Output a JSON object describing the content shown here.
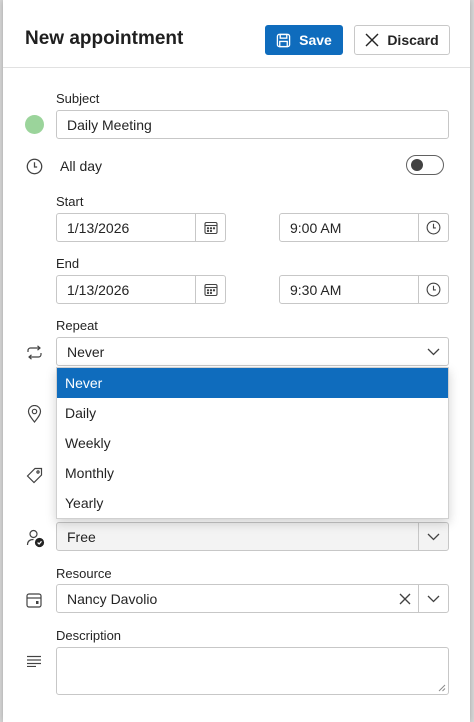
{
  "header": {
    "title": "New appointment",
    "save_label": "Save",
    "discard_label": "Discard"
  },
  "subject": {
    "label": "Subject",
    "value": "Daily Meeting",
    "color": "#9bd49b"
  },
  "all_day": {
    "label": "All day",
    "checked": false
  },
  "start": {
    "label": "Start",
    "date": "1/13/2026",
    "time": "9:00 AM"
  },
  "end": {
    "label": "End",
    "date": "1/13/2026",
    "time": "9:30 AM"
  },
  "repeat": {
    "label": "Repeat",
    "value": "Never",
    "options": [
      "Never",
      "Daily",
      "Weekly",
      "Monthly",
      "Yearly"
    ],
    "selected_index": 0
  },
  "show_as": {
    "value": "Free"
  },
  "resource": {
    "label": "Resource",
    "value": "Nancy Davolio"
  },
  "description": {
    "label": "Description",
    "value": ""
  },
  "colors": {
    "accent": "#0f6cbd"
  }
}
